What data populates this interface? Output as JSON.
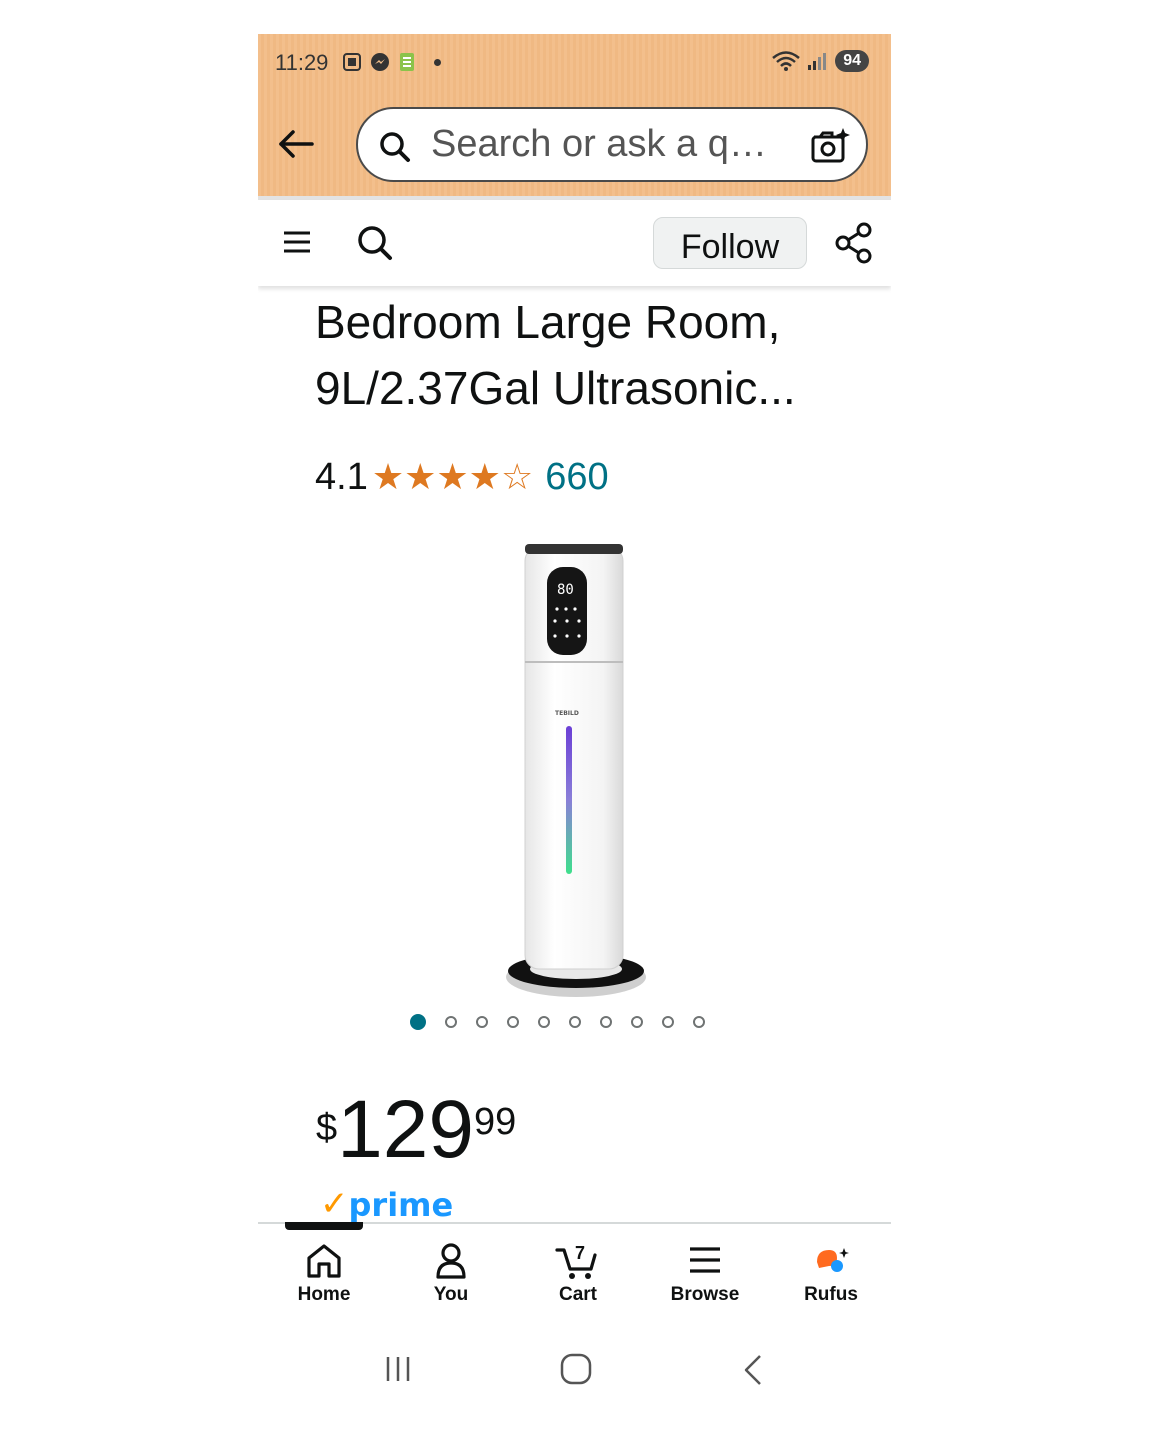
{
  "status_bar": {
    "time": "11:29",
    "battery": "94"
  },
  "search": {
    "placeholder": "Search or ask a q…"
  },
  "subbar": {
    "follow_label": "Follow"
  },
  "product": {
    "title_line1": "Bedroom Large Room,",
    "title_line2": "9L/2.37Gal Ultrasonic...",
    "rating": "4.1",
    "rating_stars": 4.1,
    "review_count": "660",
    "image_count": 10,
    "active_image": 1,
    "brand_label": "TEBILD",
    "display_value": "80",
    "price_currency": "$",
    "price_whole": "129",
    "price_fraction": "99",
    "prime_label": "prime"
  },
  "bottom_nav": {
    "cart_count": "7",
    "items": [
      {
        "label": "Home",
        "icon": "home-icon"
      },
      {
        "label": "You",
        "icon": "person-icon"
      },
      {
        "label": "Cart",
        "icon": "cart-icon"
      },
      {
        "label": "Browse",
        "icon": "menu-icon"
      },
      {
        "label": "Rufus",
        "icon": "rufus-icon"
      }
    ]
  },
  "colors": {
    "header_orange": "#f3bf8c",
    "star_orange": "#de7921",
    "link_teal": "#007185",
    "prime_blue": "#1a98ff",
    "prime_check": "#ff9900"
  }
}
